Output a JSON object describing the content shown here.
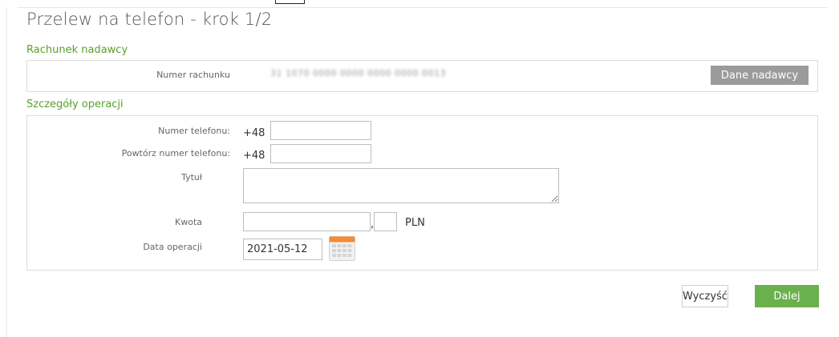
{
  "page": {
    "title": "Przelew na telefon - krok 1/2"
  },
  "sender_section": {
    "title": "Rachunek nadawcy",
    "account_label": "Numer rachunku",
    "account_value_blurred": "31 1070 0000 0000 0000 0000 0013",
    "sender_data_button": "Dane nadawcy"
  },
  "details_section": {
    "title": "Szczegóły operacji",
    "phone_label": "Numer telefonu:",
    "phone_prefix": "+48",
    "phone_value": "",
    "repeat_phone_label": "Powtórz numer telefonu:",
    "repeat_phone_prefix": "+48",
    "repeat_phone_value": "",
    "title_label": "Tytuł",
    "title_value": "",
    "amount_label": "Kwota",
    "amount_whole": "",
    "amount_separator": ",",
    "amount_fraction": "",
    "currency": "PLN",
    "date_label": "Data operacji",
    "date_value": "2021-05-12"
  },
  "actions": {
    "clear_label": "Wyczyść",
    "next_label": "Dalej"
  },
  "colors": {
    "accent_green": "#5aa02c",
    "next_button": "#6ab04c",
    "secondary_button": "#9b9b9b",
    "calendar_orange": "#f28c38"
  }
}
